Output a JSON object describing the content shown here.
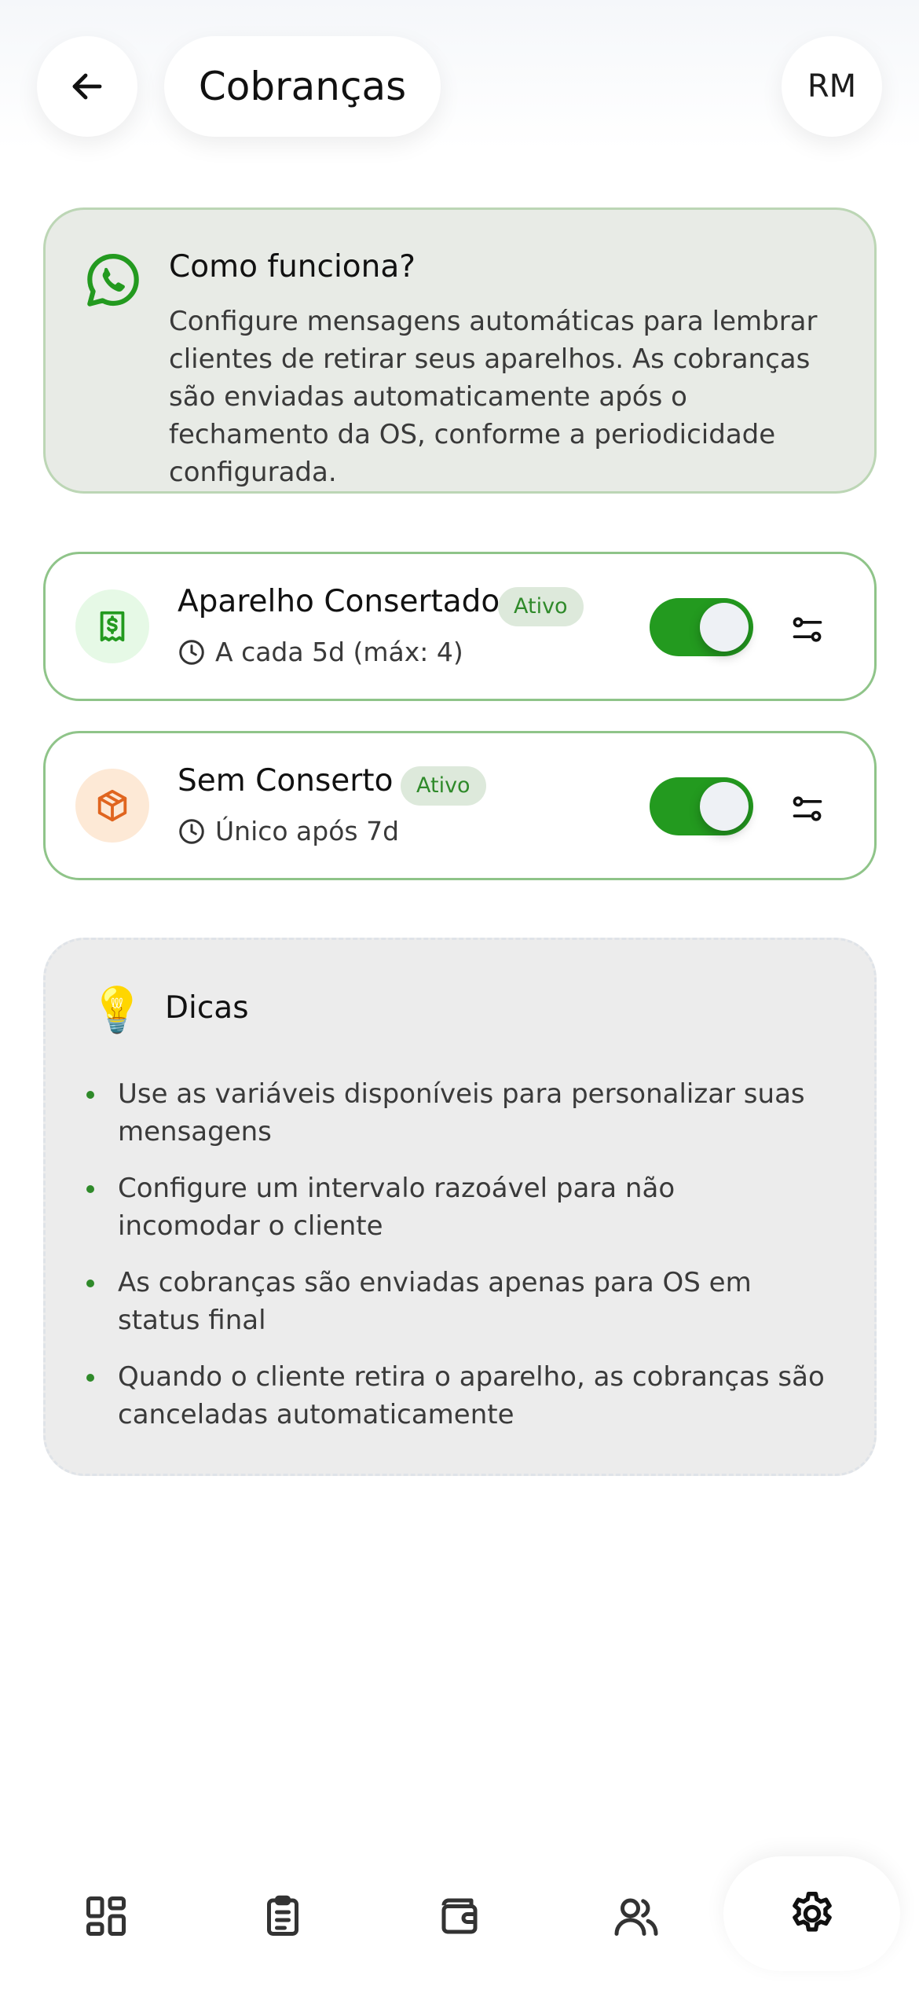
{
  "header": {
    "title": "Cobranças",
    "avatar_initials": "RM",
    "back_icon": "arrow-left-icon"
  },
  "info": {
    "icon": "whatsapp-icon",
    "title": "Como funciona?",
    "text": "Configure mensagens automáticas para lembrar clientes de retirar seus aparelhos. As cobranças são enviadas automaticamente após o fechamento da OS, conforme a periodicidade configurada."
  },
  "rules": [
    {
      "name": "Aparelho Consertado",
      "badge": "Ativo",
      "schedule": "A cada 5d (máx: 4)",
      "icon": "receipt-dollar-icon",
      "enabled": true
    },
    {
      "name": "Sem Conserto",
      "badge": "Ativo",
      "schedule": "Único após 7d",
      "icon": "package-icon",
      "enabled": true
    }
  ],
  "tips": {
    "icon": "lightbulb-icon",
    "title": "Dicas",
    "items": [
      "Use as variáveis disponíveis para personalizar suas mensagens",
      "Configure um intervalo razoável para não incomodar o cliente",
      "As cobranças são enviadas apenas para OS em status final",
      "Quando o cliente retira o aparelho, as cobranças são canceladas automaticamente"
    ]
  },
  "nav": {
    "items": [
      "dashboard-icon",
      "clipboard-icon",
      "wallet-icon",
      "users-icon",
      "settings-icon"
    ],
    "active": "settings-icon"
  },
  "colors": {
    "accent_green": "#239a1f",
    "badge_text": "#2f8a2a",
    "orange": "#e0651f"
  }
}
